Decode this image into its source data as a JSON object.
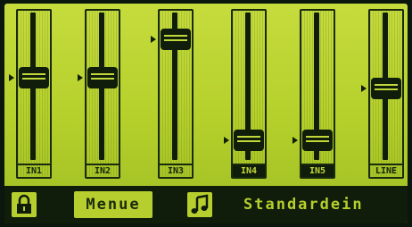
{
  "channels": [
    {
      "label": "IN1",
      "level": 0.58,
      "selected": false
    },
    {
      "label": "IN2",
      "level": 0.58,
      "selected": false
    },
    {
      "label": "IN3",
      "level": 0.88,
      "selected": false
    },
    {
      "label": "IN4",
      "level": 0.1,
      "selected": true
    },
    {
      "label": "IN5",
      "level": 0.1,
      "selected": true
    },
    {
      "label": "LINE",
      "level": 0.5,
      "selected": false
    }
  ],
  "bottom_bar": {
    "lock_icon": "padlock-icon",
    "menu_label": "Menue",
    "music_icon": "music-note-icon",
    "preset_name": "Standardein"
  },
  "colors": {
    "lcd_background": "#b7d22e",
    "lcd_ink": "#0f1d0a"
  }
}
